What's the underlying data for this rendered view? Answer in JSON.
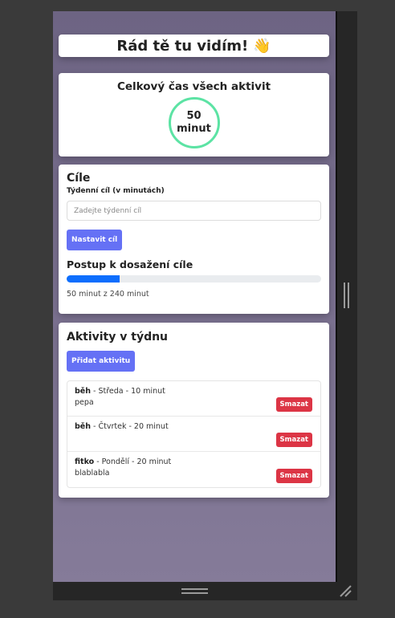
{
  "greeting": {
    "text": "Rád tě tu vidím!",
    "emoji": "👋"
  },
  "total": {
    "title": "Celkový čas všech aktivit",
    "value": "50",
    "unit": "minut"
  },
  "goals": {
    "title": "Cíle",
    "weekly_label": "Týdenní cíl (v minutách)",
    "input_placeholder": "Zadejte týdenní cíl",
    "set_button": "Nastavit cíl",
    "progress_title": "Postup k dosažení cíle",
    "progress_fraction": 0.2083,
    "progress_text": "50 minut z 240 minut"
  },
  "activities": {
    "title": "Aktivity v týdnu",
    "add_button": "Přidat aktivitu",
    "delete_label": "Smazat",
    "items": [
      {
        "name": "běh",
        "meta": " - Středa - 10 minut",
        "desc": "pepa"
      },
      {
        "name": "běh",
        "meta": " - Čtvrtek - 20 minut",
        "desc": ""
      },
      {
        "name": "fitko",
        "meta": " - Pondělí - 20 minut",
        "desc": "blablabla"
      }
    ]
  },
  "colors": {
    "accent": "#6571f5",
    "progress": "#0d6efd",
    "danger": "#dc3545",
    "ring": "#5ce3a4"
  }
}
